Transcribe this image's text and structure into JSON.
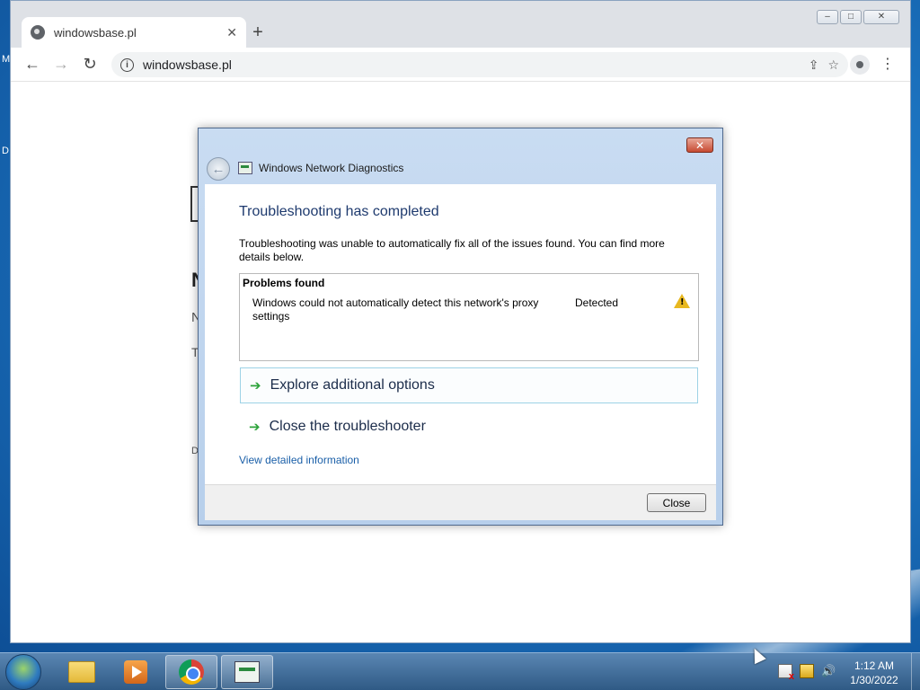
{
  "desktop": {
    "edge_labels": [
      "M",
      "D"
    ]
  },
  "browser": {
    "tab": {
      "title": "windowsbase.pl",
      "close_glyph": "✕"
    },
    "new_tab_glyph": "+",
    "window_controls": {
      "minimize": "–",
      "maximize": "□",
      "close": "✕"
    },
    "toolbar": {
      "back_glyph": "←",
      "forward_glyph": "→",
      "reload_glyph": "↻",
      "url": "windowsbase.pl",
      "info_glyph": "i",
      "share_glyph": "⇪",
      "star_glyph": "☆",
      "menu_glyph": "⋮"
    },
    "page_fragments": [
      "N",
      "N",
      "T",
      "D"
    ]
  },
  "dialog": {
    "title": "Windows Network Diagnostics",
    "close_glyph": "✕",
    "back_glyph": "←",
    "heading": "Troubleshooting has completed",
    "description": "Troubleshooting was unable to automatically fix all of the issues found. You can find more details below.",
    "problems": {
      "title": "Problems found",
      "items": [
        {
          "text": "Windows could not automatically detect this network's proxy settings",
          "status": "Detected",
          "icon": "warning-icon"
        }
      ]
    },
    "options": [
      {
        "label": "Explore additional options",
        "icon": "green-arrow-icon",
        "highlighted": true
      },
      {
        "label": "Close the troubleshooter",
        "icon": "green-arrow-icon",
        "highlighted": false
      }
    ],
    "details_link": "View detailed information",
    "close_button": "Close"
  },
  "taskbar": {
    "pinned": [
      {
        "name": "windows-explorer",
        "icon": "folder-icon",
        "active": false
      },
      {
        "name": "media-player",
        "icon": "media-player-icon",
        "active": false
      },
      {
        "name": "google-chrome",
        "icon": "chrome-icon",
        "active": false
      },
      {
        "name": "network-diagnostics",
        "icon": "network-diagnostics-icon",
        "active": true
      }
    ],
    "tray": {
      "icons": [
        "action-center-flag-icon",
        "network-warning-icon",
        "volume-icon"
      ],
      "volume_glyph": "🔊"
    },
    "clock": {
      "time": "1:12 AM",
      "date": "1/30/2022"
    }
  }
}
